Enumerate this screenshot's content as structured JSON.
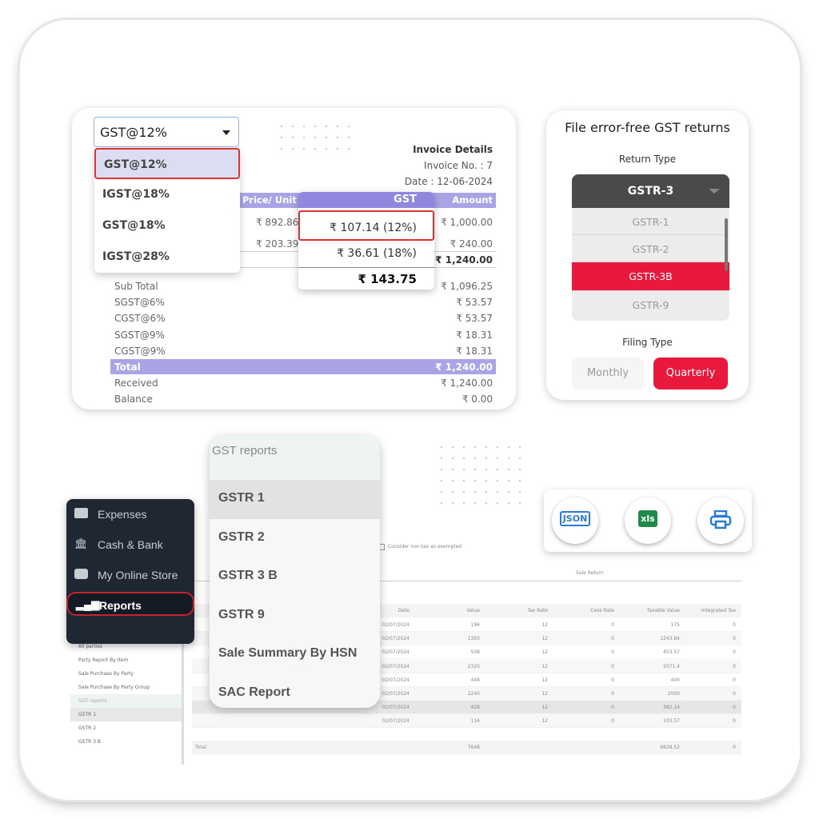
{
  "invoice": {
    "tax_select_value": "GST@12%",
    "tax_options": [
      "GST@12%",
      "IGST@18%",
      "GST@18%",
      "IGST@28%"
    ],
    "details_title": "Invoice Details",
    "invoice_no": "Invoice No. : 7",
    "date": "Date : 12-06-2024",
    "columns": {
      "price": "Price/ Unit",
      "gst": "GST",
      "amount": "Amount"
    },
    "items": [
      {
        "price": "₹ 892.86",
        "gst": "₹ 107.14 (12%)",
        "amount": "₹ 1,000.00"
      },
      {
        "price": "₹ 203.39",
        "gst": "₹ 36.61 (18%)",
        "amount": "₹ 240.00"
      }
    ],
    "items_total_amount": "₹ 1,240.00",
    "gst_total": "₹ 143.75",
    "summary": [
      {
        "label": "Sub Total",
        "value": "₹ 1,096.25"
      },
      {
        "label": "SGST@6%",
        "value": "₹ 53.57"
      },
      {
        "label": "CGST@6%",
        "value": "₹ 53.57"
      },
      {
        "label": "SGST@9%",
        "value": "₹ 18.31"
      },
      {
        "label": "CGST@9%",
        "value": "₹ 18.31"
      },
      {
        "label": "Total",
        "value": "₹ 1,240.00"
      },
      {
        "label": "Received",
        "value": "₹ 1,240.00"
      },
      {
        "label": "Balance",
        "value": "₹ 0.00"
      }
    ]
  },
  "returns": {
    "title": "File error-free GST returns",
    "return_type_label": "Return Type",
    "selected": "GSTR-3",
    "options": [
      "GSTR-1",
      "GSTR-2",
      "GSTR-3B",
      "GSTR-9"
    ],
    "highlighted": "GSTR-3B",
    "filing_type_label": "Filing Type",
    "monthly": "Monthly",
    "quarterly": "Quarterly",
    "accent": "#e8193c"
  },
  "gst_reports": {
    "title": "GST reports",
    "items": [
      "GSTR 1",
      "GSTR 2",
      "GSTR 3 B",
      "GSTR 9",
      "Sale Summary By HSN",
      "SAC Report"
    ]
  },
  "sidebar": {
    "items": [
      {
        "label": "Expenses",
        "icon": "wallet-icon"
      },
      {
        "label": "Cash & Bank",
        "icon": "bank-icon"
      },
      {
        "label": "My Online Store",
        "icon": "store-icon"
      },
      {
        "label": "Reports",
        "icon": "bar-chart-icon"
      }
    ]
  },
  "export": {
    "json": "JSON",
    "xls": "xls",
    "print": "print-icon"
  },
  "background_report": {
    "checkbox_label": "Consider non-tax as exempted",
    "tab": "Sale Return",
    "columns": [
      "Date",
      "Value",
      "Tax Rate",
      "Cess Rate",
      "Taxable Value",
      "Integrated Tax"
    ],
    "rows": [
      [
        "02/07/2024",
        "196",
        "12",
        "0",
        "175",
        "0"
      ],
      [
        "02/07/2024",
        "1393",
        "12",
        "0",
        "1243.84",
        "0"
      ],
      [
        "02/07/2024",
        "508",
        "12",
        "0",
        "453.57",
        "0"
      ],
      [
        "02/07/2024",
        "2320",
        "12",
        "0",
        "2071.4",
        "0"
      ],
      [
        "02/07/2024",
        "448",
        "12",
        "0",
        "400",
        "0"
      ],
      [
        "02/07/2024",
        "2240",
        "12",
        "0",
        "2000",
        "0"
      ],
      [
        "02/07/2024",
        "428",
        "12",
        "0",
        "382.14",
        "0"
      ],
      [
        "02/07/2024",
        "116",
        "12",
        "0",
        "103.57",
        "0"
      ]
    ],
    "total_label": "Total",
    "total_value": "7648",
    "total_taxable": "6828.52",
    "total_integrated": "0",
    "side_items": [
      "All parties",
      "Party Report By Item",
      "Sale Purchase By Party",
      "Sale Purchase By Party Group",
      "GST reports",
      "GSTR 1",
      "GSTR 2",
      "GSTR 3 B"
    ]
  }
}
